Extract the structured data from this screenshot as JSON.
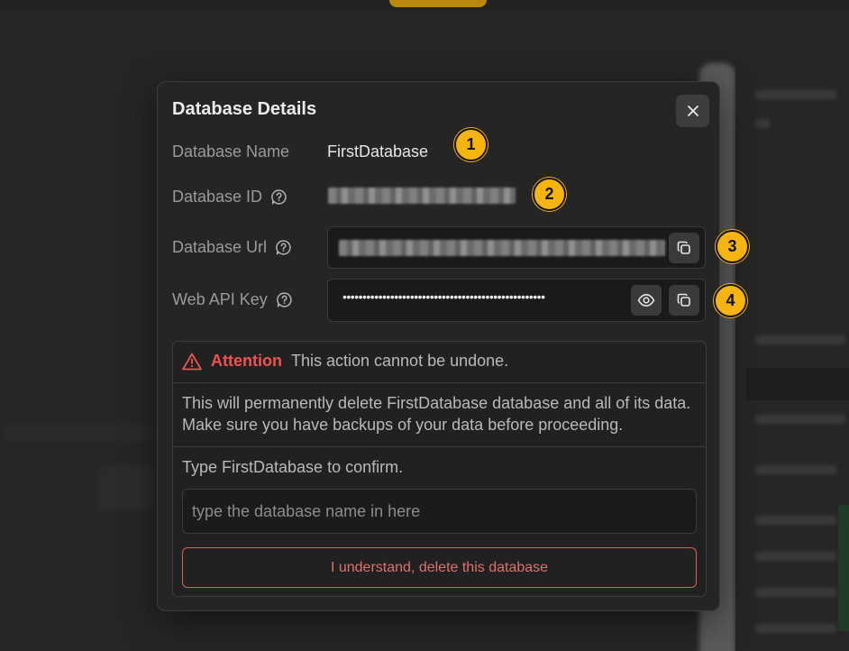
{
  "modal": {
    "title": "Database Details",
    "rows": [
      {
        "label": "Database Name",
        "value": "FirstDatabase",
        "marker": "1"
      },
      {
        "label": "Database ID",
        "marker": "2"
      },
      {
        "label": "Database Url",
        "marker": "3"
      },
      {
        "label": "Web API Key",
        "value": "•••••••••••••••••••••••••••••••••••••••••••••••••••",
        "marker": "4"
      }
    ]
  },
  "danger": {
    "attention_title": "Attention",
    "attention_text": "This action cannot be undone.",
    "description": "This will permanently delete FirstDatabase database and all of its data. Make sure you have backups of your data before proceeding.",
    "confirm_label": "Type FirstDatabase to confirm.",
    "confirm_placeholder": "type the database name in here",
    "delete_label": "I understand, delete this database"
  },
  "icons": {
    "close": "close-icon",
    "help": "help-circle-icon",
    "copy": "copy-icon",
    "show": "eye-icon",
    "warning": "warning-triangle-icon"
  },
  "colors": {
    "accent": "#f6b40e",
    "danger": "#ef5350",
    "background": "#262626",
    "modal": "#252525"
  }
}
